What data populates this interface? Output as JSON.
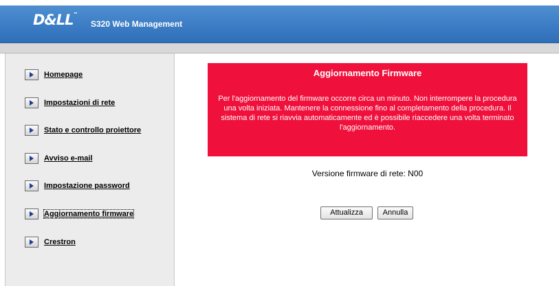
{
  "header": {
    "logo_text": "D&LL",
    "logo_tm": "™",
    "title": "S320 Web Management"
  },
  "sidebar": {
    "items": [
      {
        "label": "Homepage"
      },
      {
        "label": "Impostazioni di rete"
      },
      {
        "label": "Stato e controllo proiettore"
      },
      {
        "label": "Avviso e-mail"
      },
      {
        "label": "Impostazione password"
      },
      {
        "label": "Aggiornamento firmware"
      },
      {
        "label": "Crestron"
      }
    ]
  },
  "main": {
    "notice": {
      "title": "Aggiornamento Firmware",
      "body": "Per l'aggiornamento del firmware occorre circa un minuto. Non interrompere la procedura una volta iniziata. Mantenere la connessione fino al completamento della procedura. Il sistema di rete si riavvia automaticamente ed è possibile riaccedere una volta terminato l'aggiornamento.",
      "background": "#f0103c"
    },
    "firmware_version": "Versione firmware di rete: N00",
    "buttons": {
      "update": "Attualizza",
      "cancel": "Annulla"
    }
  },
  "colors": {
    "header": "#3d7ec6",
    "sidebar": "#ececec",
    "notice": "#f0103c"
  }
}
